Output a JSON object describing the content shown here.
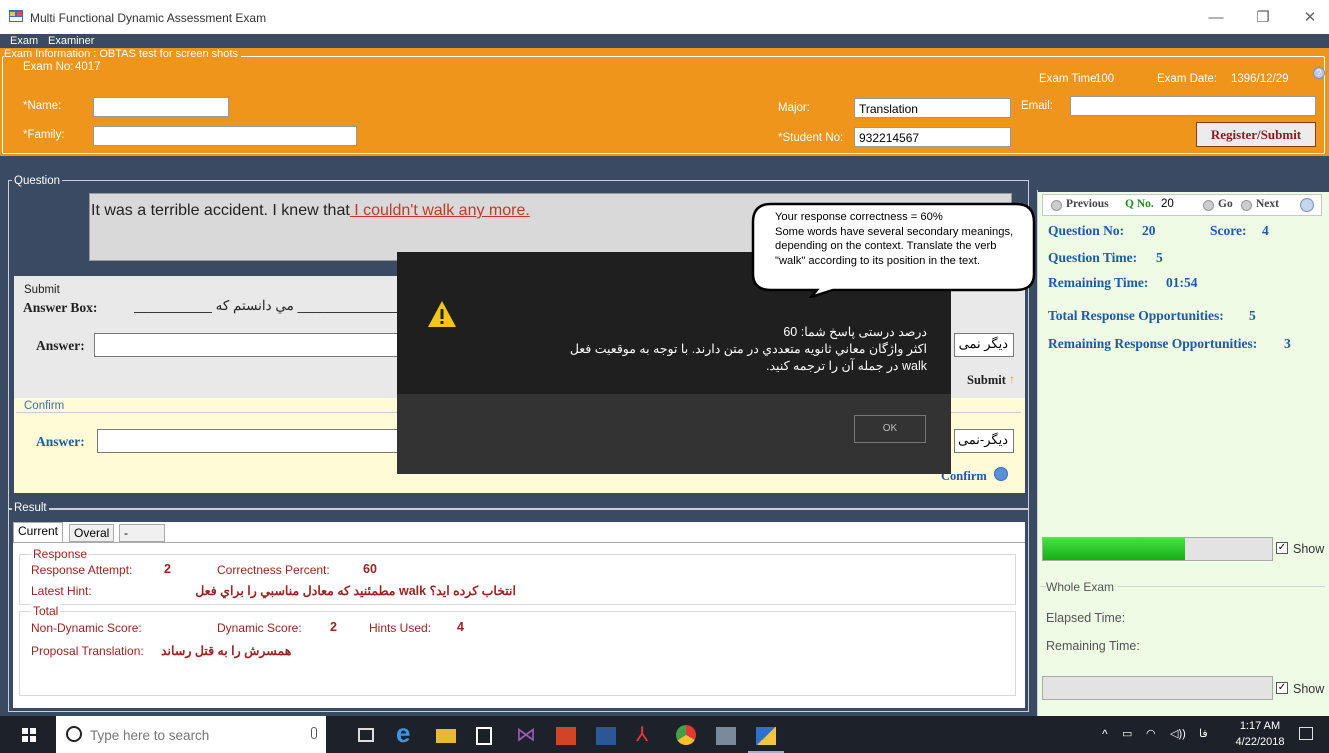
{
  "window": {
    "title": "Multi Functional Dynamic Assessment Exam",
    "minimize": "—",
    "maximize": "❐",
    "close": "✕"
  },
  "menu": {
    "items": [
      "Exam",
      "Examiner"
    ]
  },
  "exam_info": {
    "legend": "Exam Information : OBTAS test for screen shots",
    "exam_no_label": "Exam No:",
    "exam_no": "4017",
    "exam_time_label": "Exam Time:",
    "exam_time": "100",
    "exam_date_label": "Exam Date:",
    "exam_date": "1396/12/29",
    "name_label": "*Name:",
    "name_value": "",
    "family_label": "*Family:",
    "family_value": "",
    "major_label": "Major:",
    "major_value": "Translation",
    "student_no_label": "*Student No:",
    "student_no_value": "932214567",
    "email_label": "Email:",
    "email_value": "",
    "register_button": "Register/Submit"
  },
  "question": {
    "legend": "Question",
    "text_plain": "It was a terrible accident. I knew that",
    "text_underlined": " I couldn't walk any more."
  },
  "submit": {
    "legend": "Submit",
    "answer_box_label": "Answer Box:",
    "answer_box_text": "._______________ مي دانستم كه ______________ بود.",
    "answer_label": "Answer:",
    "answer_value": "دیگر نمی",
    "submit_button": "Submit"
  },
  "confirm": {
    "legend": "Confirm",
    "answer_label": "Answer:",
    "answer_value": "دیگر-نمی",
    "confirm_button": "Confirm"
  },
  "right_panel": {
    "nav_previous": "Previous",
    "nav_q_label": "Q No.",
    "nav_q_value": "20",
    "nav_go": "Go",
    "nav_next": "Next",
    "question_no_label": "Question No:",
    "question_no": "20",
    "score_label": "Score:",
    "score": "4",
    "question_time_label": "Question Time:",
    "question_time": "5",
    "remaining_time_label": "Remaining Time:",
    "remaining_time": "01:54",
    "total_opps_label": "Total Response Opportunities:",
    "total_opps": "5",
    "remaining_opps_label": "Remaining Response Opportunities:",
    "remaining_opps": "3",
    "progress_fraction": 0.62,
    "show_label": "Show",
    "whole_exam_legend": "Whole Exam",
    "elapsed_label": "Elapsed Time:",
    "remaining_exam_label": "Remaining Time:",
    "show_label_2": "Show"
  },
  "result": {
    "legend": "Result",
    "tabs": [
      "Current",
      "Overal",
      "-"
    ],
    "response_legend": "Response",
    "attempt_label": "Response Attempt:",
    "attempt": "2",
    "correctness_label": "Correctness Percent:",
    "correctness": "60",
    "hint_label": "Latest Hint:",
    "hint": "انتخاب كرده ايد؟ walk مطمئنيد كه معادل مناسبي را براي فعل",
    "total_legend": "Total",
    "non_dynamic_label": "Non-Dynamic Score:",
    "dynamic_label": "Dynamic Score:",
    "dynamic": "2",
    "hints_label": "Hints Used:",
    "hints": "4",
    "proposal_label": "Proposal Translation:",
    "proposal": "همسرش را به قتل رساند"
  },
  "dialog": {
    "line1": "درصد درستی پاسخ شما: 60",
    "line2": "اكثر واژگان معاني ثانويه متعددي در متن دارند. با توجه به موقعيت فعل",
    "line3": "walk در جمله آن را ترجمه كنيد.",
    "ok": "OK"
  },
  "bubble": {
    "line1": "Your response correctness = 60%",
    "line2": "Some words have several secondary meanings, depending on the context. Translate the verb \"walk\" according to its position in the text."
  },
  "taskbar": {
    "search_placeholder": "Type here to search",
    "lang": "فا",
    "time": "1:17 AM",
    "date": "4/22/2018"
  },
  "colors": {
    "orange": "#f0951c",
    "navy": "#3a4a63",
    "label_blue": "#1e5aa8",
    "result_red": "#9b2323",
    "progress_green": "#22c022"
  }
}
